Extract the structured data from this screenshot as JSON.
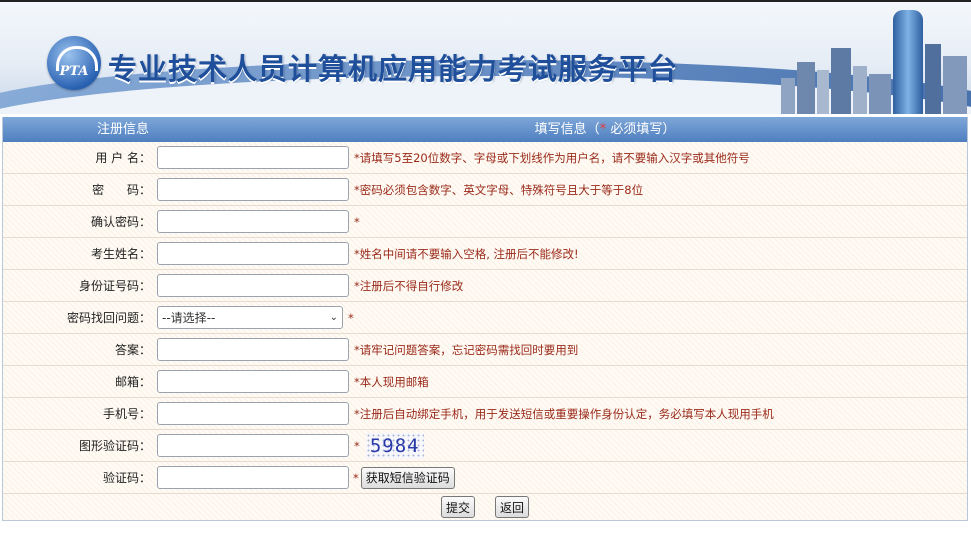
{
  "site": {
    "title": "专业技术人员计算机应用能力考试服务平台",
    "logo_text": "PTA"
  },
  "table_header": {
    "left": "注册信息",
    "right_prefix": "填写信息（",
    "right_star": "*",
    "right_suffix": "  必须填写）"
  },
  "fields": {
    "username": {
      "label": "用 户 名：",
      "value": "",
      "hint": "*请填写5至20位数字、字母或下划线作为用户名，请不要输入汉字或其他符号"
    },
    "password": {
      "label": "密      码：",
      "value": "",
      "hint": "*密码必须包含数字、英文字母、特殊符号且大于等于8位"
    },
    "confirm_password": {
      "label": "确认密码：",
      "value": "",
      "hint": "*"
    },
    "real_name": {
      "label": "考生姓名：",
      "value": "",
      "hint": "*姓名中间请不要输入空格, 注册后不能修改!"
    },
    "id_number": {
      "label": "身份证号码：",
      "value": "",
      "hint": "*注册后不得自行修改"
    },
    "security_question": {
      "label": "密码找回问题：",
      "selected": "--请选择--",
      "hint": "*"
    },
    "answer": {
      "label": "答案：",
      "value": "",
      "hint": "*请牢记问题答案，忘记密码需找回时要用到"
    },
    "email": {
      "label": "邮箱：",
      "value": "",
      "hint": "*本人现用邮箱"
    },
    "phone": {
      "label": "手机号：",
      "value": "",
      "hint": "*注册后自动绑定手机，用于发送短信或重要操作身份认定，务必填写本人现用手机"
    },
    "captcha": {
      "label": "图形验证码：",
      "value": "",
      "hint": "*",
      "image_text": "5984"
    },
    "sms_code": {
      "label": "验证码：",
      "value": "",
      "hint": "*",
      "button": "获取短信验证码"
    }
  },
  "buttons": {
    "submit": "提交",
    "back": "返回"
  },
  "colors": {
    "header_blue": "#4f7fc0",
    "hint_red": "#9b2a1b",
    "title_blue": "#1f4f9a"
  }
}
